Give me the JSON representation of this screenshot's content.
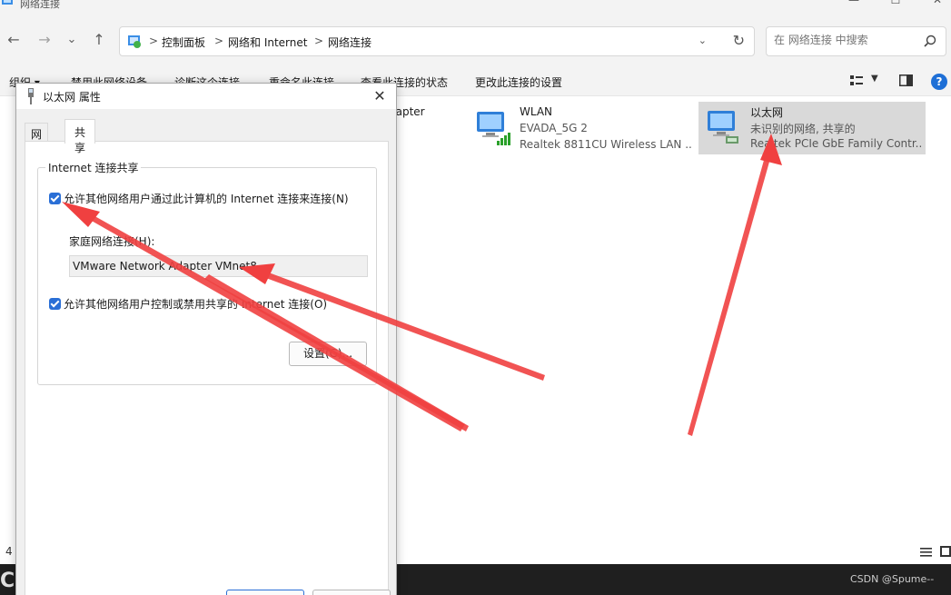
{
  "window": {
    "title": "网络连接",
    "minimize_glyph": "—",
    "maximize_glyph": "☐",
    "close_glyph": "✕"
  },
  "nav": {
    "back_glyph": "←",
    "forward_glyph": "→",
    "recent_glyph": "⌄",
    "up_glyph": "↑",
    "breadcrumb": [
      "控制面板",
      "网络和 Internet",
      "网络连接"
    ],
    "separator": ">",
    "search_placeholder": "在 网络连接 中搜索"
  },
  "commands": {
    "organize": "组织 ▾",
    "disable": "禁用此网络设备",
    "diagnose": "诊断这个连接",
    "rename": "重命名此连接",
    "view_status": "查看此连接的状态",
    "change_settings": "更改此连接的设置",
    "help": "?"
  },
  "connections": [
    {
      "name": "",
      "status": "",
      "device": "dapter"
    },
    {
      "name": "WLAN",
      "status": "EVADA_5G 2",
      "device": "Realtek 8811CU Wireless LAN ..."
    },
    {
      "name": "以太网",
      "status": "未识别的网络, 共享的",
      "device": "Realtek PCIe GbE Family Contr..."
    }
  ],
  "statusbar": {
    "item_count": "4"
  },
  "dialog": {
    "title": "以太网 属性",
    "tabs": [
      "网络",
      "共享"
    ],
    "group_title": "Internet 连接共享",
    "allow_connect_label": "允许其他网络用户通过此计算机的 Internet 连接来连接(N)",
    "home_network_label": "家庭网络连接(H):",
    "home_network_value": "VMware Network Adapter VMnet8",
    "allow_control_label": "允许其他网络用户控制或禁用共享的 Internet 连接(O)",
    "settings_button": "设置(G)..."
  },
  "watermark": "CSDN @Spume--",
  "taskbar_letter": "C",
  "colors": {
    "accent": "#2a6fd6",
    "arrow": "#f04040"
  }
}
